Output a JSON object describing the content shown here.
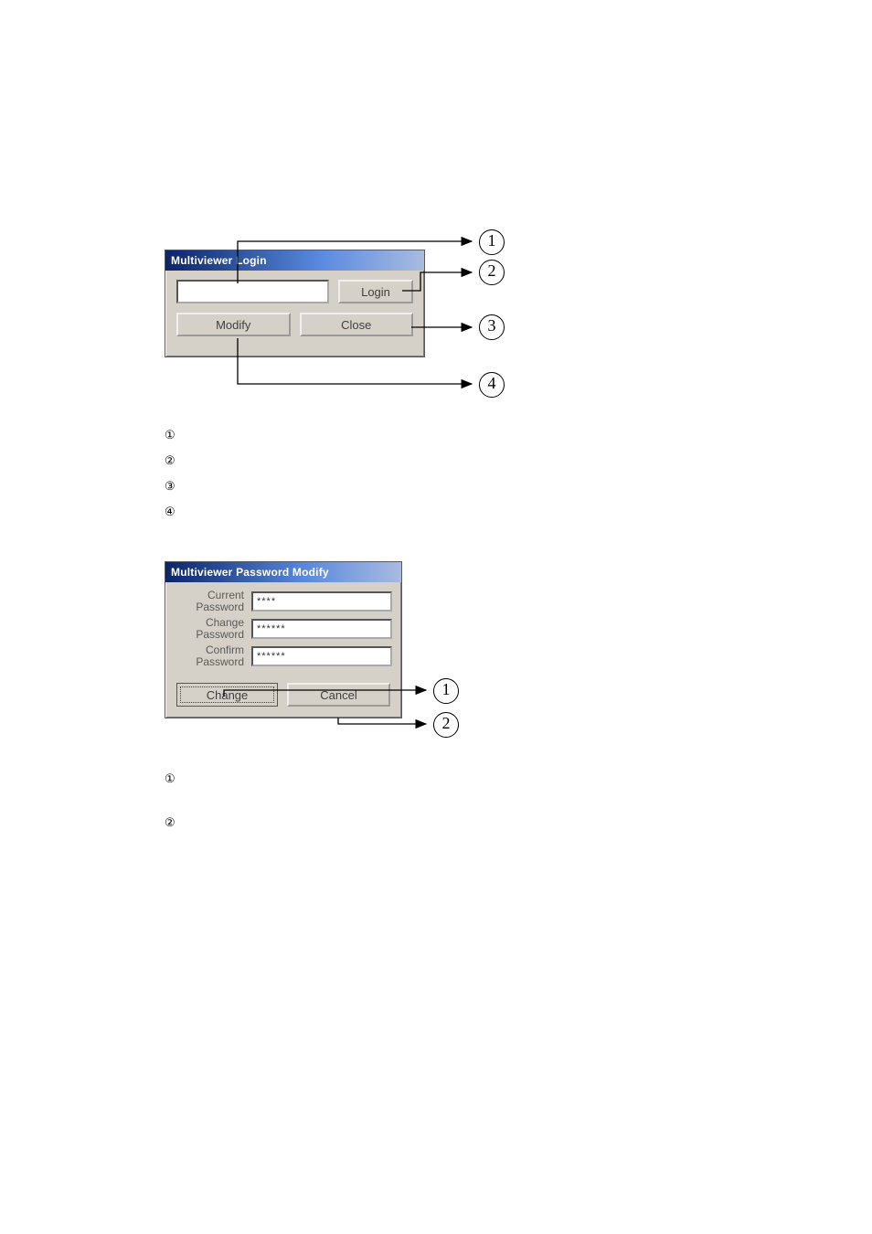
{
  "dlg1": {
    "title": "Multiviewer Login",
    "input_value": "",
    "login": "Login",
    "modify": "Modify",
    "close": "Close"
  },
  "callout1": {
    "c1": "1",
    "c2": "2",
    "c3": "3",
    "c4": "4"
  },
  "list1": [
    "①",
    "②",
    "③",
    "④"
  ],
  "dlg2": {
    "title": "Multiviewer Password Modify",
    "cur_label_1": "Current",
    "cur_label_2": "Password",
    "chg_label_1": "Change",
    "chg_label_2": "Password",
    "cfm_label_1": "Confirm",
    "cfm_label_2": "Password",
    "cur_val": "****",
    "chg_val": "******",
    "cfm_val": "******",
    "change": "Change",
    "cancel": "Cancel"
  },
  "callout2": {
    "c1": "1",
    "c2": "2"
  },
  "list2": [
    "①",
    "②"
  ]
}
